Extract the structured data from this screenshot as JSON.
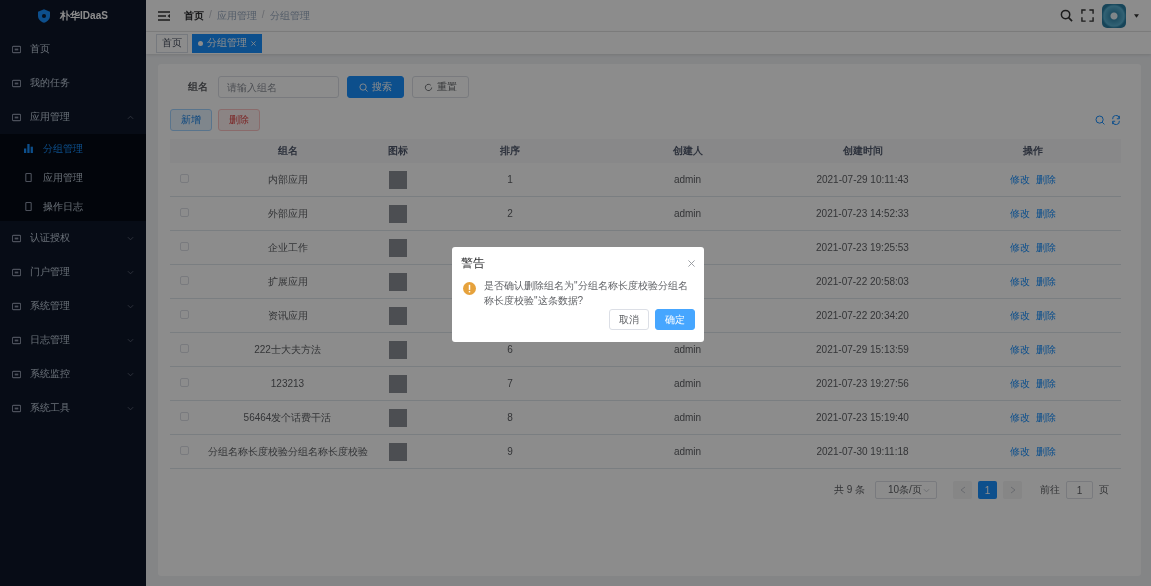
{
  "app": {
    "name": "朴华IDaaS"
  },
  "sidebar": {
    "items": [
      {
        "label": "首页",
        "selected": false
      },
      {
        "label": "我的任务",
        "selected": false
      },
      {
        "label": "应用管理",
        "selected": false,
        "expanded": true,
        "children": [
          {
            "label": "分组管理",
            "selected": true
          },
          {
            "label": "应用管理",
            "selected": false
          },
          {
            "label": "操作日志",
            "selected": false
          }
        ]
      },
      {
        "label": "认证授权",
        "selected": false,
        "expanded": false
      },
      {
        "label": "门户管理",
        "selected": false,
        "expanded": false
      },
      {
        "label": "系统管理",
        "selected": false,
        "expanded": false
      },
      {
        "label": "日志管理",
        "selected": false,
        "expanded": false
      },
      {
        "label": "系统监控",
        "selected": false,
        "expanded": false
      },
      {
        "label": "系统工具",
        "selected": false,
        "expanded": false
      }
    ]
  },
  "breadcrumb": {
    "separator": "/",
    "items": [
      "首页",
      "应用管理",
      "分组管理"
    ]
  },
  "tags": [
    {
      "label": "首页",
      "selected": false
    },
    {
      "label": "分组管理",
      "selected": true
    }
  ],
  "search": {
    "label": "组名",
    "placeholder": "请输入组名",
    "buttons": [
      {
        "label": "搜索",
        "kind": "primary"
      },
      {
        "label": "重置",
        "kind": "default"
      }
    ]
  },
  "actions": [
    {
      "label": "新增",
      "kind": "primary"
    },
    {
      "label": "删除",
      "kind": "danger"
    }
  ],
  "table": {
    "columns": [
      "组名",
      "图标",
      "排序",
      "创建人",
      "创建时间",
      "操作"
    ],
    "rows": [
      {
        "checked": false,
        "name": "内部应用",
        "order": "1",
        "creator": "admin",
        "created": "2021-07-29 10:11:43",
        "actions": [
          "修改",
          "删除"
        ]
      },
      {
        "checked": false,
        "name": "外部应用",
        "order": "2",
        "creator": "admin",
        "created": "2021-07-23 14:52:33",
        "actions": [
          "修改",
          "删除"
        ]
      },
      {
        "checked": false,
        "name": "企业工作",
        "created": "2021-07-23 19:25:53",
        "actions": [
          "修改",
          "删除"
        ]
      },
      {
        "checked": false,
        "name": "扩展应用",
        "created": "2021-07-22 20:58:03",
        "actions": [
          "修改",
          "删除"
        ]
      },
      {
        "checked": false,
        "name": "资讯应用",
        "created": "2021-07-22 20:34:20",
        "actions": [
          "修改",
          "删除"
        ]
      },
      {
        "checked": false,
        "name": "222士大夫方法",
        "order": "6",
        "creator": "admin",
        "created": "2021-07-29 15:13:59",
        "actions": [
          "修改",
          "删除"
        ]
      },
      {
        "checked": false,
        "name": "123213",
        "order": "7",
        "creator": "admin",
        "created": "2021-07-23 19:27:56",
        "actions": [
          "修改",
          "删除"
        ]
      },
      {
        "checked": false,
        "name": "56464发个话费干活",
        "order": "8",
        "creator": "admin",
        "created": "2021-07-23 15:19:40",
        "actions": [
          "修改",
          "删除"
        ]
      },
      {
        "checked": false,
        "name": "分组名称长度校验分组名称长度校验",
        "order": "9",
        "creator": "admin",
        "created": "2021-07-30 19:11:18",
        "actions": [
          "修改",
          "删除"
        ]
      }
    ]
  },
  "pagination": {
    "total": "共 9 条",
    "page_size": "10条/页",
    "pages": [
      {
        "label": "1",
        "selected": true
      }
    ],
    "goto_label": "前往",
    "goto_value": "1",
    "goto_suffix": "页"
  },
  "dialog": {
    "title": "警告",
    "message": "是否确认删除组名为\"分组名称长度校验分组名称长度校验\"这条数据?",
    "buttons": [
      {
        "label": "取消",
        "kind": "default"
      },
      {
        "label": "确定",
        "kind": "primary"
      }
    ]
  }
}
